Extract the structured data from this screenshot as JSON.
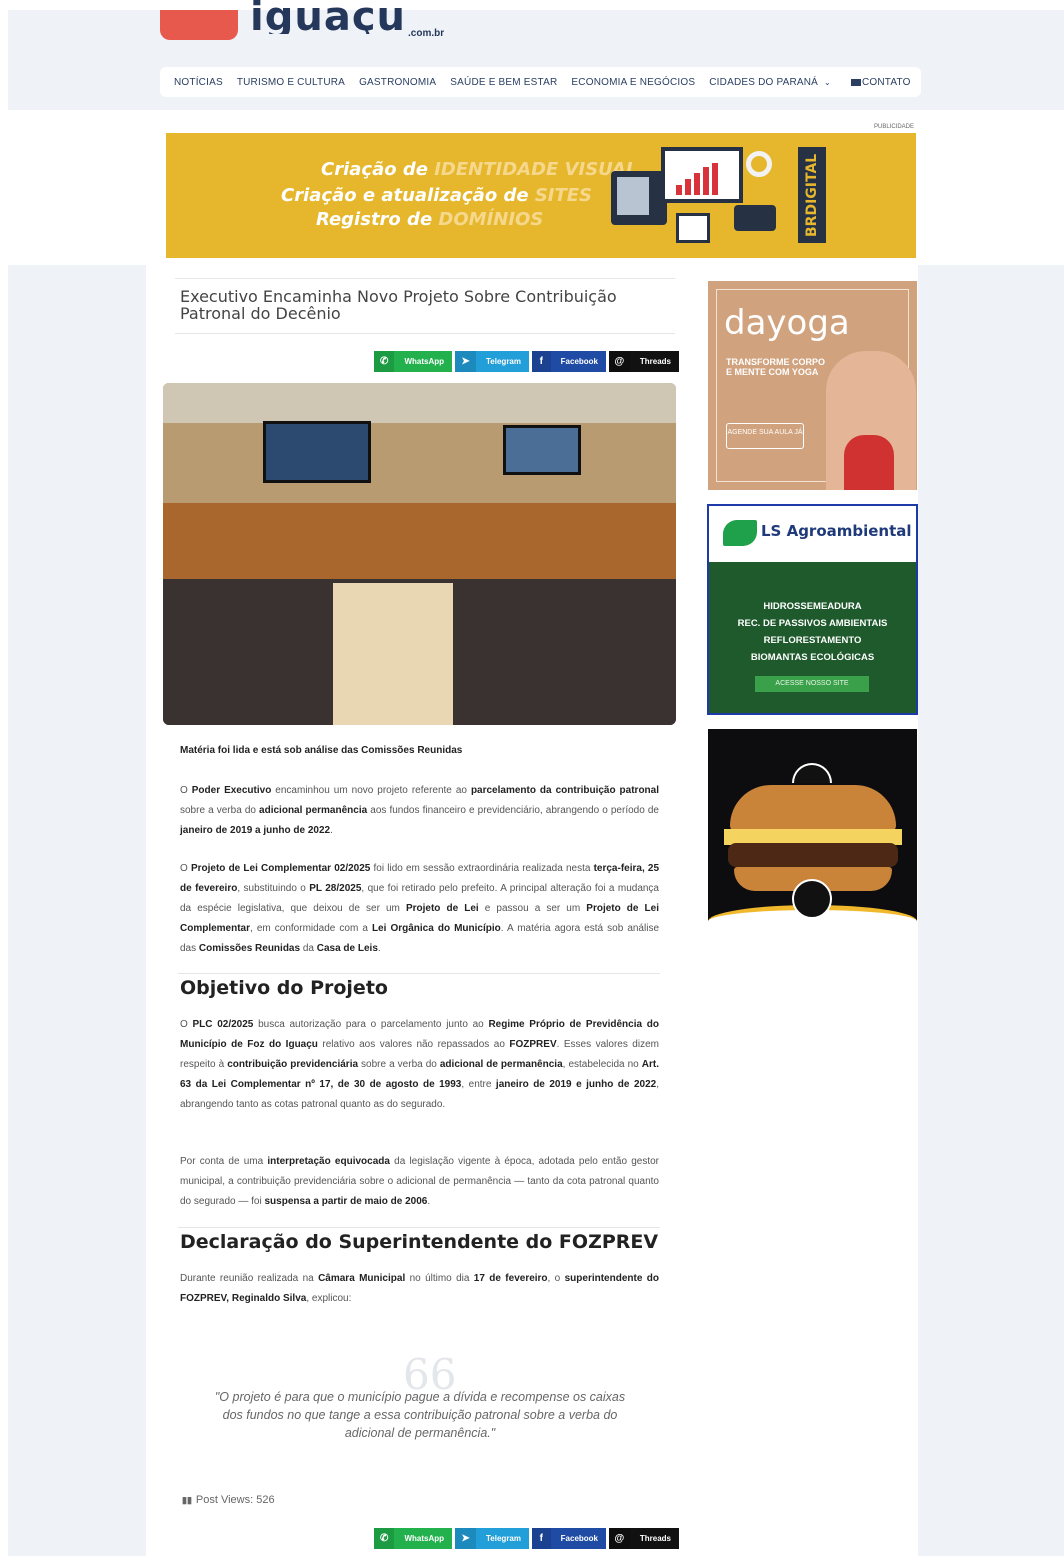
{
  "site": {
    "logo_text": "iguaçu",
    "logo_suffix": ".com.br"
  },
  "nav": {
    "items": [
      "NOTÍCIAS",
      "TURISMO E CULTURA",
      "GASTRONOMIA",
      "SAÚDE E BEM ESTAR",
      "ECONOMIA E NEGÓCIOS",
      "CIDADES DO PARANÁ"
    ],
    "contact": "CONTATO"
  },
  "banner": {
    "label": "PUBLICIDADE",
    "line1_a": "Criação de ",
    "line1_b": "IDENTIDADE VISUAL",
    "line2_a": "Criação e atualização de ",
    "line2_b": "SITES",
    "line3_a": "Registro de ",
    "line3_b": "DOMÍNIOS",
    "brand": "BRDIGITAL"
  },
  "article": {
    "title": "Executivo Encaminha Novo Projeto Sobre Contribuição Patronal do Decênio",
    "caption": "Matéria foi lida e está sob análise das Comissões Reunidas",
    "h2_objetivo": "Objetivo do Projeto",
    "h2_declaracao": "Declaração do Superintendente do FOZPREV",
    "quote": "\"O projeto é para que o município pague a dívida e recompense os caixas dos fundos no que tange a essa contribuição patronal sobre a verba do adicional de permanência.\"",
    "views_label": "Post Views: 526"
  },
  "share": {
    "whatsapp": "WhatsApp",
    "telegram": "Telegram",
    "facebook": "Facebook",
    "threads": "Threads"
  },
  "ads": {
    "yoga": {
      "brand": "dayoga",
      "tagline": "TRANSFORME CORPO E MENTE COM YOGA",
      "cta": "AGENDE SUA AULA JÁ"
    },
    "ls": {
      "brand": "LS Agroambiental",
      "services": [
        "HIDROSSEMEADURA",
        "REC. DE PASSIVOS AMBIENTAIS",
        "REFLORESTAMENTO",
        "BIOMANTAS ECOLÓGICAS"
      ],
      "cta": "ACESSE NOSSO SITE"
    }
  },
  "colors": {
    "nav_text": "#2a3e62",
    "banner_bg": "#e6b72d",
    "whatsapp": "#22b14c",
    "telegram": "#229ed9",
    "facebook": "#1f4ba5",
    "threads": "#111111"
  }
}
